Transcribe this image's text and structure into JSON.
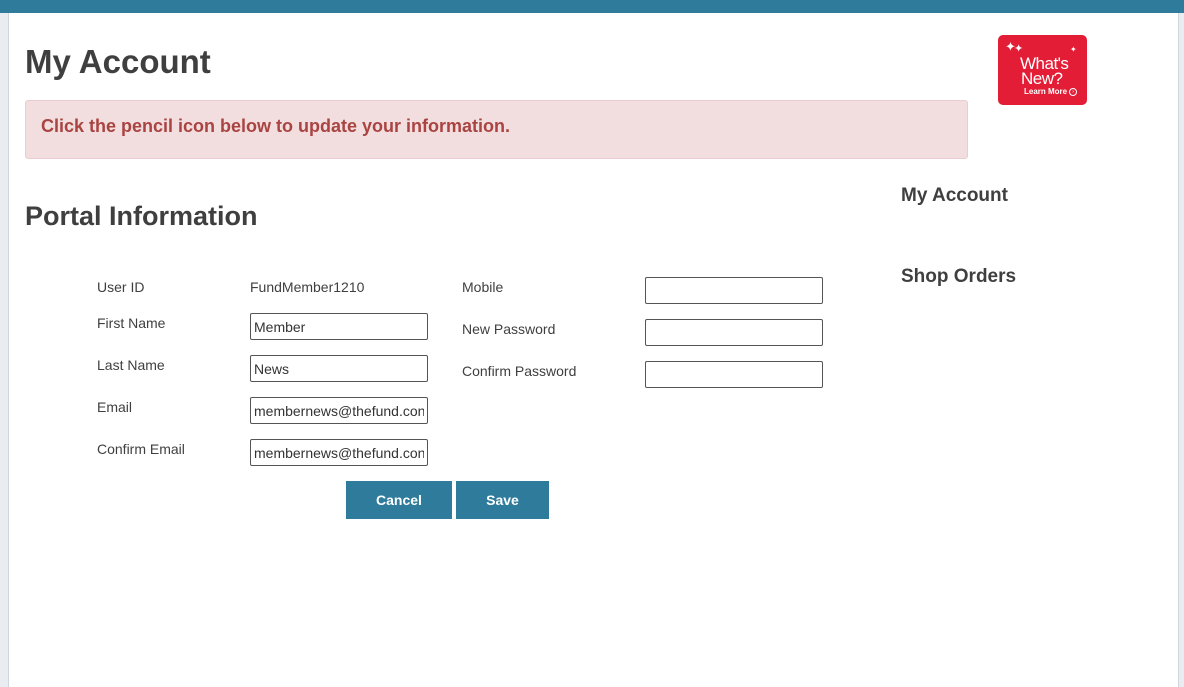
{
  "header": {
    "page_title": "My Account"
  },
  "alert": {
    "text": "Click the pencil icon below to update your information."
  },
  "promo": {
    "line1": "What's",
    "line2": "New?",
    "learn_more": "Learn More",
    "color": "#e31d35"
  },
  "section": {
    "title": "Portal Information"
  },
  "sidebar": {
    "items": [
      {
        "label": "My Account"
      },
      {
        "label": "Shop Orders"
      }
    ]
  },
  "form": {
    "user_id": {
      "label": "User ID",
      "value": "FundMember1210"
    },
    "first_name": {
      "label": "First Name",
      "value": "Member"
    },
    "last_name": {
      "label": "Last Name",
      "value": "News"
    },
    "email": {
      "label": "Email",
      "value": "membernews@thefund.con"
    },
    "confirm_email": {
      "label": "Confirm Email",
      "value": "membernews@thefund.con"
    },
    "mobile": {
      "label": "Mobile",
      "value": ""
    },
    "new_password": {
      "label": "New Password",
      "value": ""
    },
    "confirm_password": {
      "label": "Confirm Password",
      "value": ""
    }
  },
  "buttons": {
    "cancel": "Cancel",
    "save": "Save"
  },
  "colors": {
    "accent": "#2e7b9b",
    "alert_bg": "#f2dede",
    "alert_text": "#a94442"
  }
}
